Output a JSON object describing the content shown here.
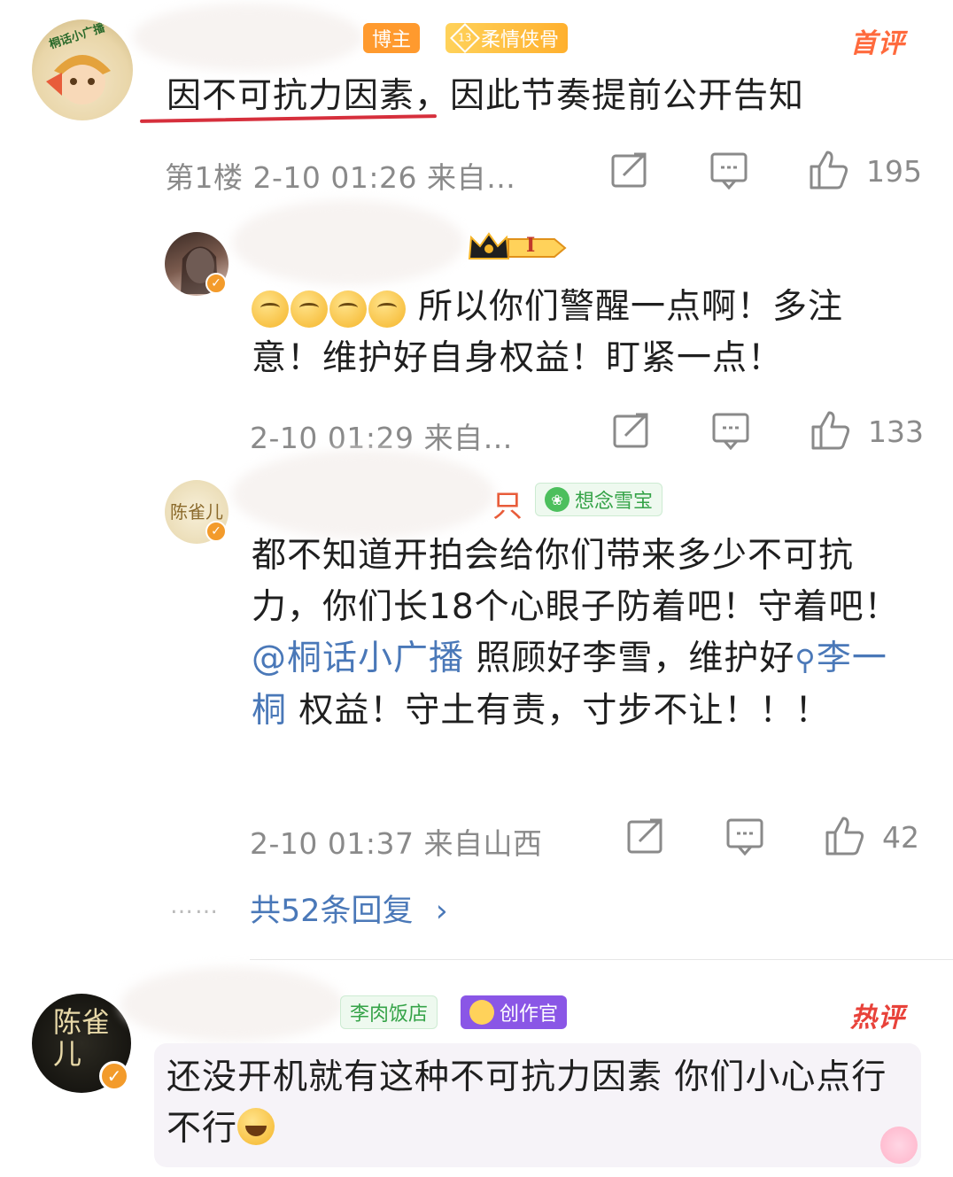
{
  "comment1": {
    "badges": {
      "role": "博主",
      "fan_level": "13",
      "fan_title": "柔情侠骨"
    },
    "tag": "首评",
    "avatar_text": "桐话小广播",
    "text": "因不可抗力因素，因此节奏提前公开告知",
    "meta": "第1楼 2-10 01:26 来自…",
    "likes": "195"
  },
  "reply1": {
    "crown_text": "I",
    "text": "所以你们警醒一点啊！多注意！维护好自身权益！盯紧一点！",
    "meta": "2-10 01:29 来自…",
    "likes": "133"
  },
  "reply2": {
    "name_tail": "只",
    "group_badge": "想念雪宝",
    "text_before": "都不知道开拍会给你们带来多少不可抗力，你们长18个心眼子防着吧！守着吧！",
    "mention": "@桐话小广播",
    "text_mid": " 照顾好李雪，维护好",
    "search_link": "李一桐",
    "text_after": " 权益！守土有责，寸步不让！！！",
    "meta": "2-10 01:37 来自山西",
    "likes": "42"
  },
  "more_replies": "共52条回复",
  "dots": "……",
  "comment2": {
    "badges": {
      "shop": "李肉饭店",
      "creator": "创作官"
    },
    "tag": "热评",
    "avatar_text": "陈雀儿",
    "text": "还没开机就有这种不可抗力因素 你们小心点行不行"
  }
}
